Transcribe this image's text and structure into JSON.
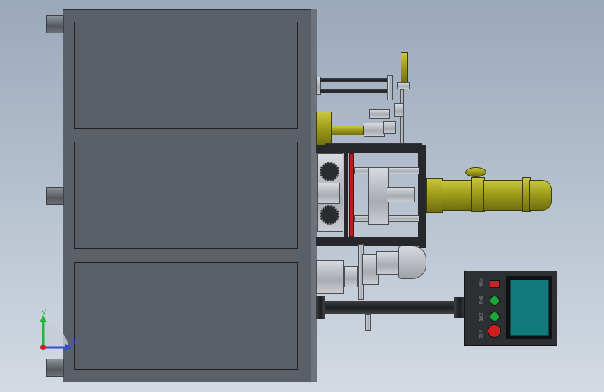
{
  "viewport": {
    "background_top": "#9aa8bb",
    "background_bottom": "#d3dae3"
  },
  "control_panel": {
    "labels": [
      "停止",
      "启动",
      "复位",
      "急停"
    ],
    "button_colors": [
      "#cc2222",
      "#1aa83a",
      "#1aa83a",
      "#d11f1f"
    ],
    "screen_color": "#117a7a"
  },
  "triad": {
    "y_label": "Y",
    "z_label": "Z",
    "y_color": "#1fb83a",
    "z_color": "#2f50d6",
    "x_color": "#d32020"
  },
  "colors": {
    "cabinet": "#5b5f68",
    "cylinder": "#a5a21b",
    "frame": "#26282b",
    "red_plate": "#b81e1e"
  }
}
